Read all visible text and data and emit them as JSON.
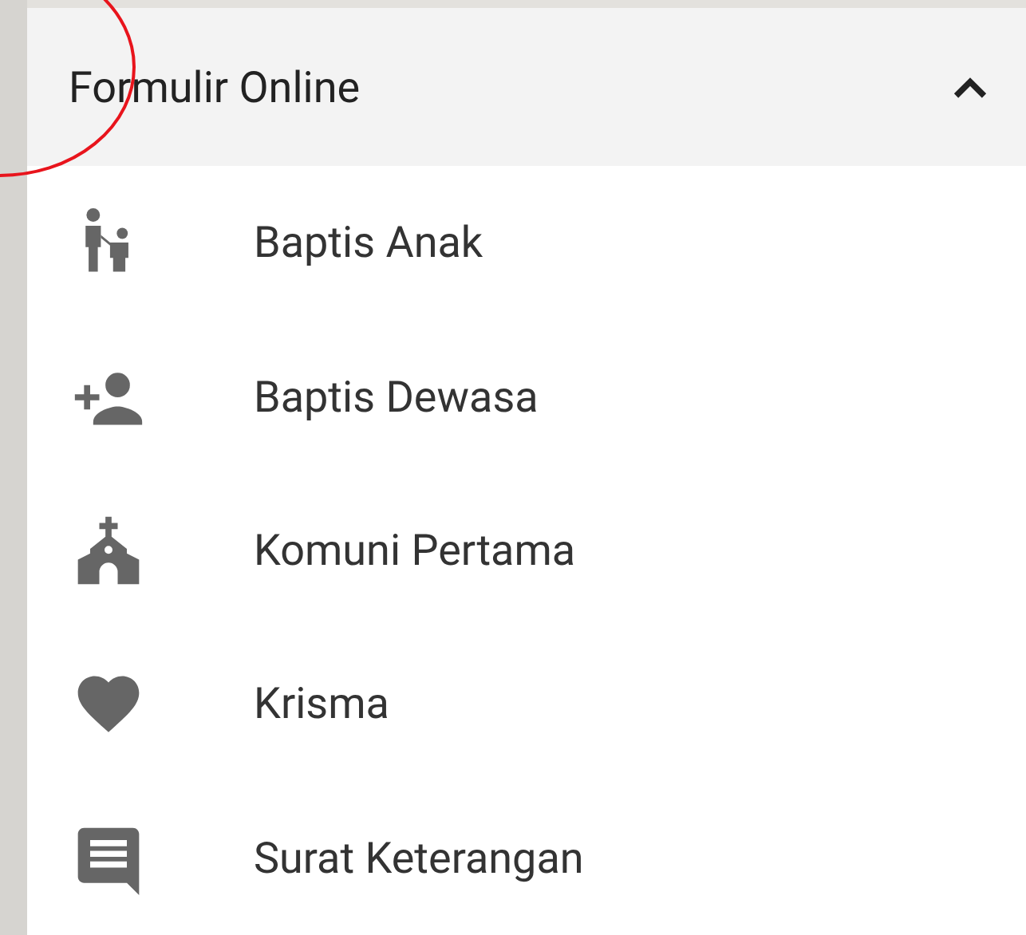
{
  "menu": {
    "title": "Formulir Online",
    "expanded": true,
    "items": [
      {
        "kind": "parent-child",
        "label": "Baptis Anak"
      },
      {
        "kind": "add-person",
        "label": "Baptis Dewasa"
      },
      {
        "kind": "church",
        "label": "Komuni Pertama"
      },
      {
        "kind": "heart",
        "label": "Krisma"
      },
      {
        "kind": "message",
        "label": "Surat Keterangan"
      }
    ]
  }
}
